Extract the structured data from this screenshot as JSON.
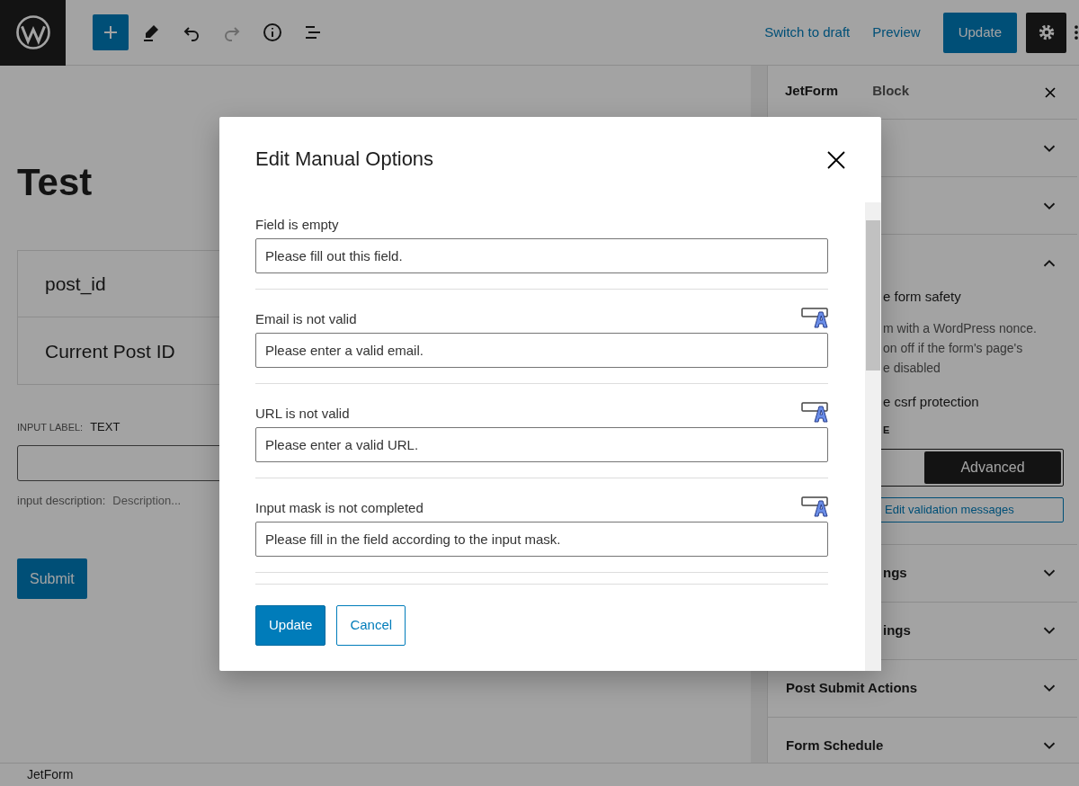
{
  "topbar": {
    "tools": [
      {
        "kind": "add"
      },
      {
        "kind": "edit"
      },
      {
        "kind": "undo",
        "disabled": false
      },
      {
        "kind": "redo",
        "disabled": true
      },
      {
        "kind": "info"
      },
      {
        "kind": "list"
      }
    ],
    "links": [
      "Switch to draft",
      "Preview"
    ],
    "update": "Update"
  },
  "editor": {
    "title": "Test",
    "fields": [
      "post_id",
      "Current Post ID"
    ],
    "input_label_caption": "INPUT LABEL:",
    "input_label_value": "TEXT",
    "description_caption": "input description:",
    "description_placeholder": "Description...",
    "submit": "Submit"
  },
  "sidebar": {
    "tabs": [
      {
        "label": "JetForm",
        "selected": true
      },
      {
        "label": "Block",
        "selected": false
      }
    ],
    "panels": [
      {
        "expanded": false
      },
      {
        "expanded": false
      },
      {
        "expanded": true,
        "content": {
          "toggle_label": "e form safety",
          "help": [
            "m with a WordPress nonce.",
            "on off if the form's page's",
            "e disabled"
          ],
          "toggle2_label": "e csrf protection",
          "type_caption": "E",
          "segments": [
            {
              "label": "Advanced",
              "selected": true
            }
          ],
          "edit_button": "Edit validation messages"
        }
      },
      {
        "title": "ngs",
        "expanded": false
      },
      {
        "title": "ings",
        "expanded": false
      },
      {
        "title": "Post Submit Actions",
        "expanded": false
      },
      {
        "title": "Form Schedule",
        "expanded": false
      }
    ]
  },
  "modal": {
    "title": "Edit Manual Options",
    "items": [
      {
        "label": "Field is empty",
        "value": "Please fill out this field.",
        "has_format_icon": false
      },
      {
        "label": "Email is not valid",
        "value": "Please enter a valid email.",
        "has_format_icon": true
      },
      {
        "label": "URL is not valid",
        "value": "Please enter a valid URL.",
        "has_format_icon": true
      },
      {
        "label": "Input mask is not completed",
        "value": "Please fill in the field according to the input mask.",
        "has_format_icon": true
      }
    ],
    "buttons": [
      {
        "label": "Update",
        "kind": "primary"
      },
      {
        "label": "Cancel",
        "kind": "secondary"
      }
    ]
  },
  "footer": {
    "breadcrumb": "JetForm"
  }
}
